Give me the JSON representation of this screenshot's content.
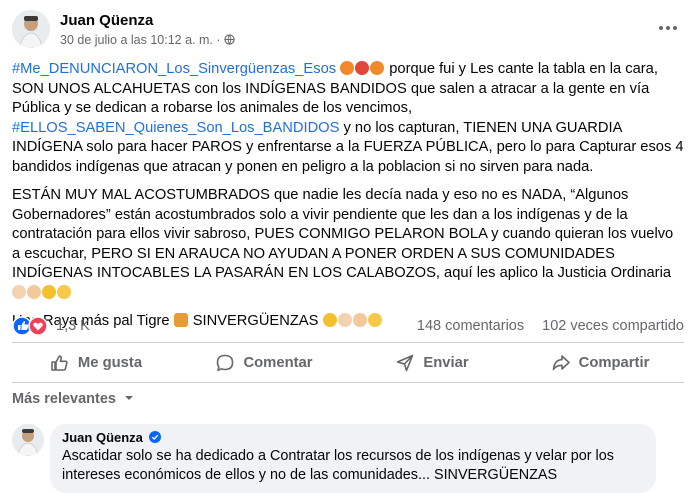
{
  "post": {
    "author": "Juan Qüenza",
    "timestamp": "30 de julio a las 10:12 a. m.",
    "privacy_separator": "·",
    "privacy_icon": "globe-icon",
    "more_icon": "more-options-icon",
    "paragraph1": {
      "tag1": "#Me_DENUNCIARON_Los_Sinvergüenzas_Esos",
      "emojis1": [
        "angry-face",
        "angry-red-face",
        "angry-face"
      ],
      "text1": " porque fui y Les cante la tabla en la cara, SON UNOS ALCAHUETAS con los INDÍGENAS BANDIDOS que salen a atracar a la gente en vía Pública y se dedican a robarse los animales de los vencimos, ",
      "tag2": "#ELLOS_SABEN_Quienes_Son_Los_BANDIDOS",
      "text2": " y no los capturan, TIENEN UNA GUARDIA INDÍGENA solo para hacer PAROS y enfrentarse a la FUERZA PÚBLICA, pero lo para Capturar esos 4 bandidos indígenas que atracan y ponen en peligro a la poblacion si no sirven para nada."
    },
    "paragraph2": {
      "text": "ESTÁN MUY MAL ACOSTUMBRADOS que nadie les decía nada y eso no es NADA, “Algunos Gobernadores” están acostumbrados solo a vivir pendiente que les dan a los indígenas y de la contratación para ellos vivir sabroso, PUES CONMIGO PELARON BOLA y cuando quieran los vuelvo a escuchar, PERO SI EN ARAUCA NO AYUDAN A PONER ORDEN A SUS COMUNIDADES INDÍGENAS INTOCABLES LA PASARÁN EN LOS CALABOZOS, aquí les aplico la Justicia Ordinaria ",
      "emojis": [
        "flexed-biceps",
        "folded-hands",
        "thumbs-up",
        "face-with-monocle"
      ]
    },
    "paragraph3": {
      "text1": "Una Raya más pal Tigre ",
      "emoji_tiger": "tiger",
      "text2": " SINVERGÜENZAS ",
      "emojis": [
        "thumbs-up",
        "flexed-biceps",
        "folded-hands",
        "face-with-monocle"
      ]
    }
  },
  "stats": {
    "reactions": [
      "like",
      "love"
    ],
    "reaction_count": "1,3 K",
    "comments": "148 comentarios",
    "shares": "102 veces compartido"
  },
  "actions": {
    "like": "Me gusta",
    "comment": "Comentar",
    "send": "Enviar",
    "share": "Compartir"
  },
  "comments_section": {
    "sort_label": "Más relevantes",
    "comment": {
      "author": "Juan Qüenza",
      "verified": true,
      "text": "Ascatidar solo se ha dedicado a Contratar los recursos de los indígenas y velar por los intereses económicos de ellos y no de las comunidades... SINVERGÜENZAS"
    }
  },
  "colors": {
    "link": "#216fdb",
    "secondary_text": "#65676b",
    "like_blue": "#0866ff",
    "love_red": "#f33e58",
    "bubble": "#f0f2f5"
  }
}
